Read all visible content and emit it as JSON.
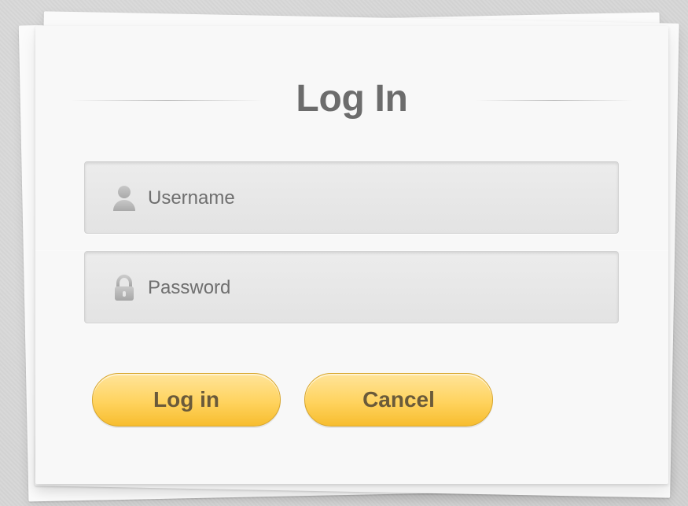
{
  "login_form": {
    "title": "Log In",
    "username": {
      "placeholder": "Username",
      "icon": "user-icon"
    },
    "password": {
      "placeholder": "Password",
      "icon": "lock-icon"
    },
    "buttons": {
      "login_label": "Log in",
      "cancel_label": "Cancel"
    }
  },
  "colors": {
    "background": "#d6d6d6",
    "card": "#f8f8f8",
    "title": "#6c6c6c",
    "field_bg": "#e8e8e8",
    "button_gold": "#ffd35e",
    "button_text": "#6a5a3a"
  }
}
